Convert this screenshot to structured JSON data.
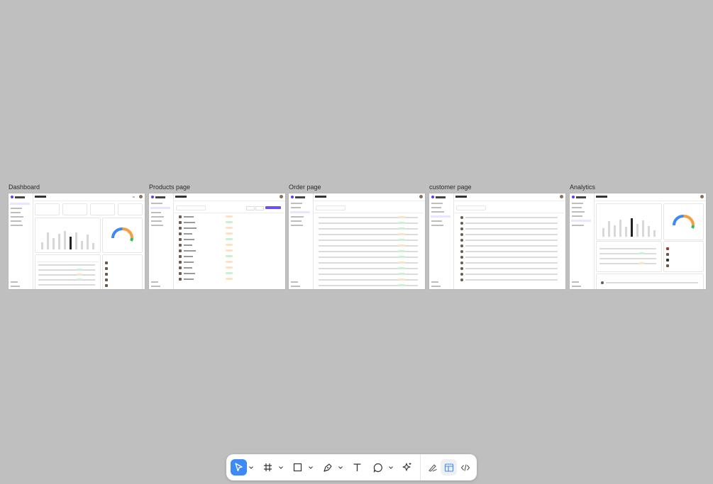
{
  "frames": [
    {
      "title": "Dashboard"
    },
    {
      "title": "Products page"
    },
    {
      "title": "Order page"
    },
    {
      "title": "customer page"
    },
    {
      "title": "Analytics"
    }
  ],
  "toolbar": {
    "tools": [
      {
        "name": "move-tool",
        "icon": "cursor-arrow-icon",
        "active": true
      },
      {
        "name": "frame-tool",
        "icon": "frame-hash-icon"
      },
      {
        "name": "shape-tool",
        "icon": "rectangle-icon"
      },
      {
        "name": "pen-tool",
        "icon": "pen-nib-icon"
      },
      {
        "name": "text-tool",
        "icon": "text-t-icon"
      },
      {
        "name": "comment-tool",
        "icon": "speech-bubble-icon"
      },
      {
        "name": "actions-tool",
        "icon": "sparkle-icon"
      },
      {
        "name": "draw-mode",
        "icon": "pencil-scribble-icon"
      },
      {
        "name": "design-mode",
        "icon": "layout-panel-icon",
        "selected": true
      },
      {
        "name": "dev-mode",
        "icon": "code-brackets-icon"
      }
    ],
    "accent": "#3b8af6"
  }
}
